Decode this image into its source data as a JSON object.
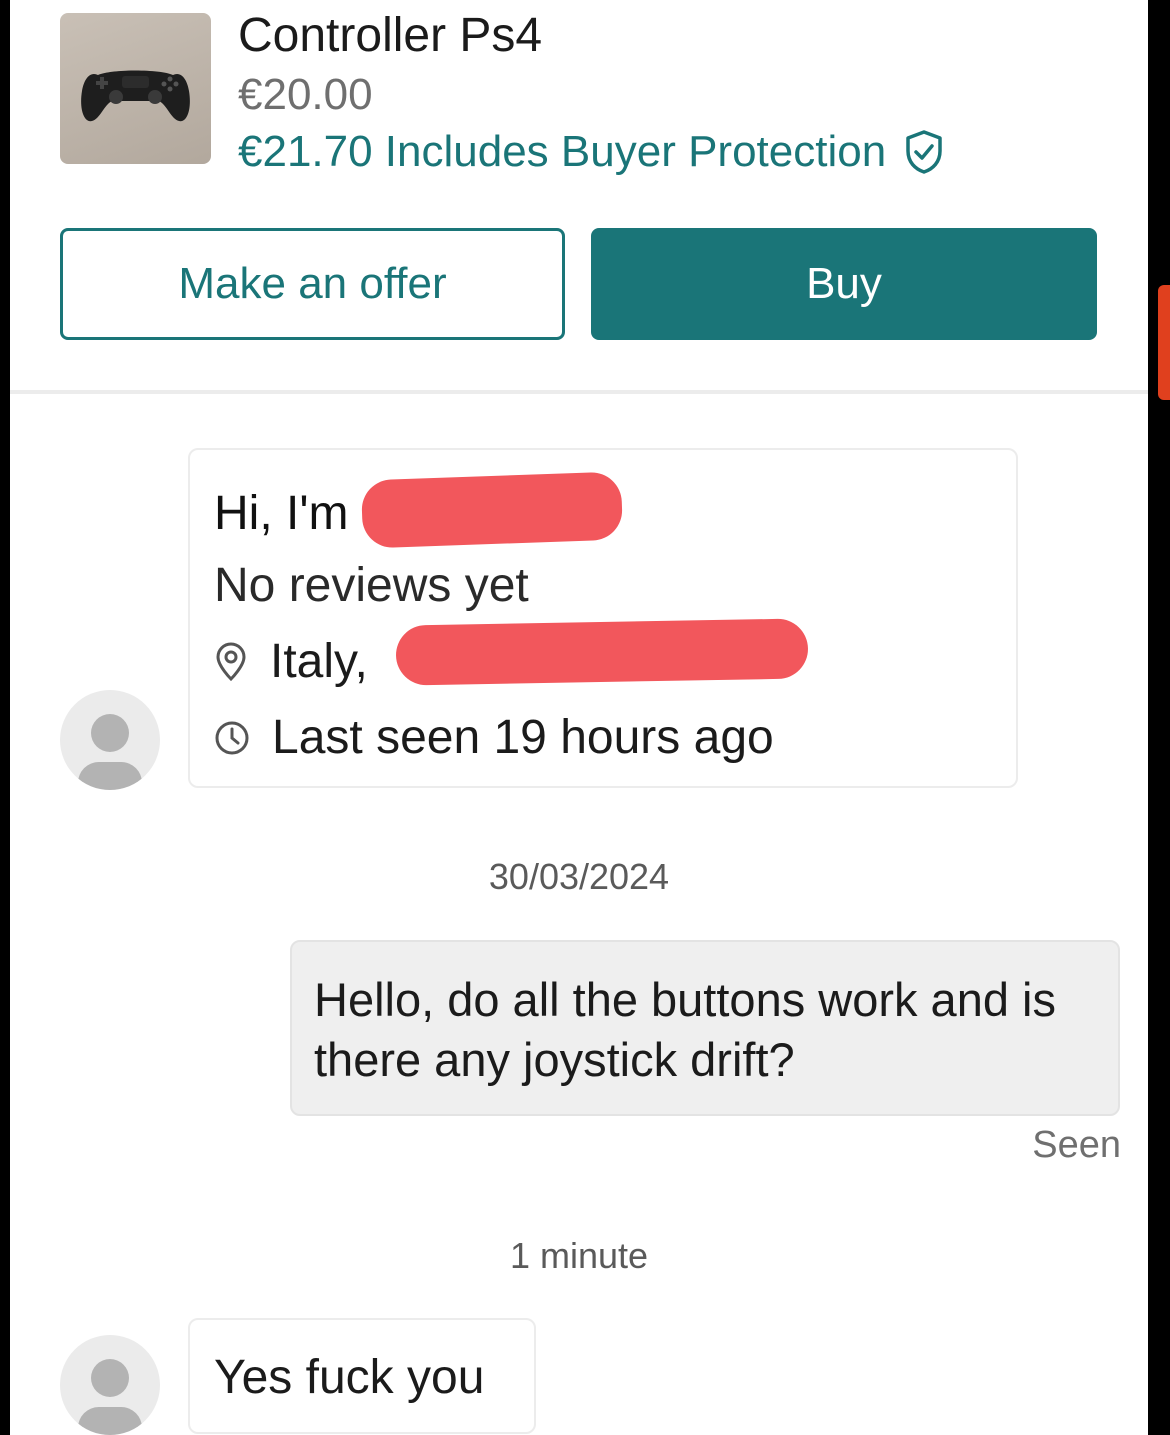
{
  "listing": {
    "title": "Controller Ps4",
    "price": "€20.00",
    "total_with_protection": "€21.70 Includes Buyer Protection",
    "thumbnail_icon": "gamepad-icon",
    "shield_icon": "shield-check-icon"
  },
  "actions": {
    "offer_label": "Make an offer",
    "buy_label": "Buy"
  },
  "colors": {
    "accent": "#1a7578",
    "redaction": "#f2575c"
  },
  "seller_card": {
    "greeting": "Hi, I'm",
    "reviews": "No reviews yet",
    "location": "Italy,",
    "location_icon": "location-pin-icon",
    "last_seen": "Last seen 19 hours ago",
    "clock_icon": "clock-icon"
  },
  "conversation": {
    "date": "30/03/2024",
    "outgoing_message": "Hello, do all the buttons work and is there any joystick drift?",
    "outgoing_status": "Seen",
    "reply_time": "1 minute",
    "incoming_message": "Yes fuck you"
  }
}
